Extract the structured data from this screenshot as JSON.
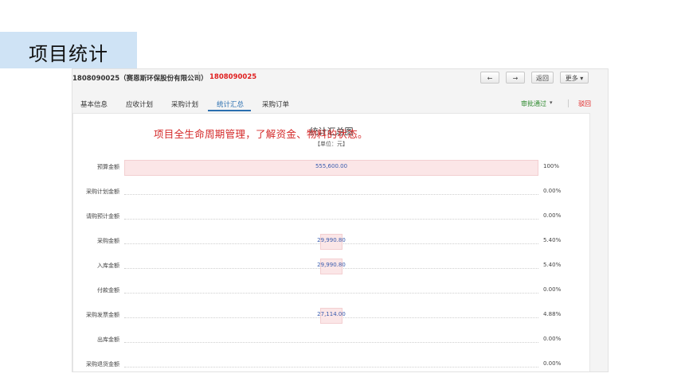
{
  "slide_title": "项目统计",
  "header": {
    "code_company": "1808090025（赛恩斯环保股份有限公司）",
    "project_id": "1808090025",
    "back_arrow": "←",
    "forward_arrow": "→",
    "return_label": "返回",
    "more_label": "更多 ▾"
  },
  "tabs": [
    {
      "label": "基本信息"
    },
    {
      "label": "应收计划"
    },
    {
      "label": "采购计划"
    },
    {
      "label": "统计汇总"
    },
    {
      "label": "采购订单"
    }
  ],
  "active_tab": 3,
  "actions": {
    "approve_label": "审批通过",
    "approve_caret": "▾",
    "reject_label": "驳回"
  },
  "overlay_note": "项目全生命周期管理，了解资金、物料的状态。",
  "chart_data": {
    "type": "bar",
    "orientation": "horizontal",
    "title": "统计汇总图",
    "unit": "【单位：元】",
    "xlim": [
      0,
      555600
    ],
    "categories": [
      "预算金额",
      "采购计划金额",
      "请购预计金额",
      "采购金额",
      "入库金额",
      "付款金额",
      "采购发票金额",
      "出库金额",
      "采购退货金额"
    ],
    "values": [
      555600,
      0,
      0,
      29990.8,
      29990.8,
      0,
      27114,
      0,
      0
    ],
    "value_labels": [
      "555,600.00",
      "",
      "",
      "29,990.80",
      "29,990.80",
      "",
      "27,114.00",
      "",
      ""
    ],
    "percent_labels": [
      "100%",
      "0.00%",
      "0.00%",
      "5.40%",
      "5.40%",
      "0.00%",
      "4.88%",
      "0.00%",
      "0.00%"
    ],
    "bar_color": "#fbe6e7",
    "label_color": "#3a5cae"
  }
}
